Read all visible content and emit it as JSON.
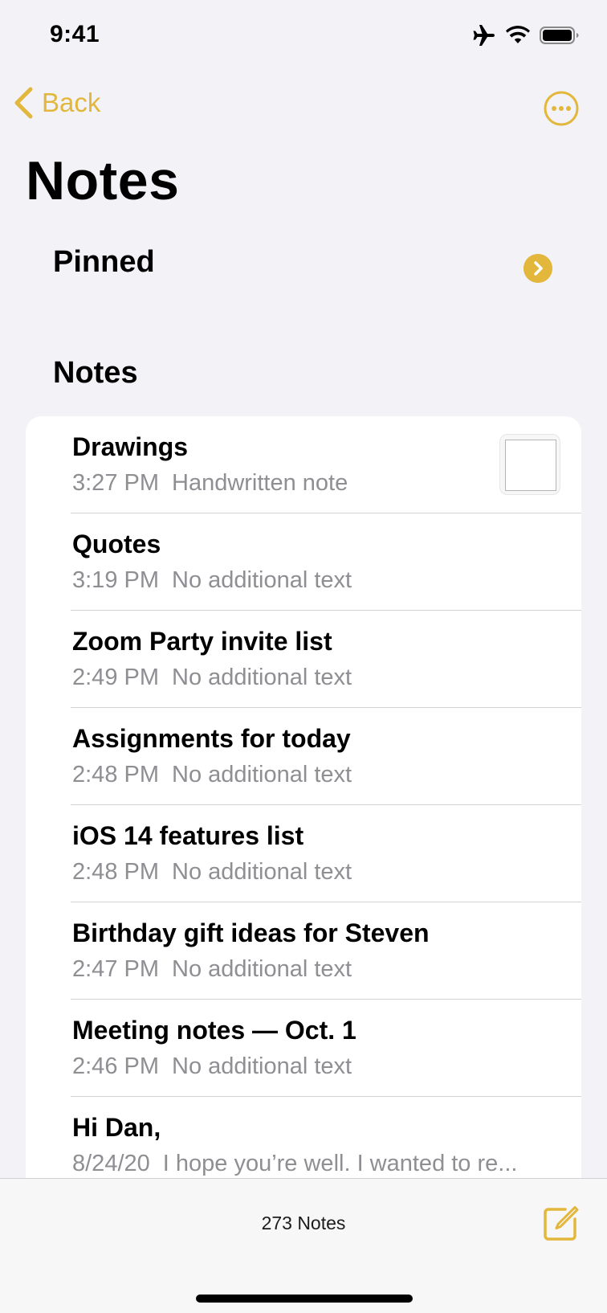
{
  "status_bar": {
    "time": "9:41",
    "icons": [
      "airplane-icon",
      "wifi-icon",
      "battery-icon"
    ]
  },
  "nav": {
    "back_label": "Back",
    "more_icon": "ellipsis-circle-icon"
  },
  "page_title": "Notes",
  "pinned": {
    "label": "Pinned",
    "icon": "chevron-right-circle-icon"
  },
  "notes_section": {
    "label": "Notes",
    "items": [
      {
        "title": "Drawings",
        "date": "3:27 PM",
        "preview": "Handwritten note",
        "has_thumbnail": true
      },
      {
        "title": "Quotes",
        "date": "3:19 PM",
        "preview": "No additional text"
      },
      {
        "title": "Zoom Party invite list",
        "date": "2:49 PM",
        "preview": "No additional text"
      },
      {
        "title": "Assignments for today",
        "date": "2:48 PM",
        "preview": "No additional text"
      },
      {
        "title": "iOS 14 features list",
        "date": "2:48 PM",
        "preview": "No additional text"
      },
      {
        "title": "Birthday gift ideas for Steven",
        "date": "2:47 PM",
        "preview": "No additional text"
      },
      {
        "title": "Meeting notes — Oct. 1",
        "date": "2:46 PM",
        "preview": "No additional text"
      },
      {
        "title": "Hi Dan,",
        "date": "8/24/20",
        "preview": "I hope you’re well. I wanted to re..."
      }
    ]
  },
  "toolbar": {
    "note_count": "273 Notes",
    "compose_icon": "compose-icon"
  },
  "colors": {
    "accent": "#e2b73c",
    "background": "#f2f2f7",
    "secondary_text": "#8e8e93"
  }
}
